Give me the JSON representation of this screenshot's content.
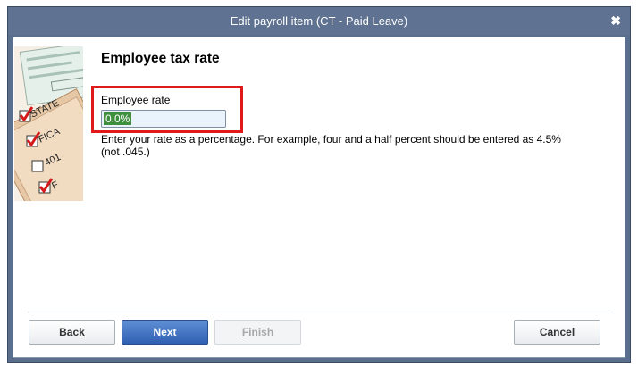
{
  "window": {
    "title": "Edit payroll item (CT - Paid Leave)",
    "close_label": "✖"
  },
  "page": {
    "heading": "Employee tax rate",
    "field_label": "Employee rate",
    "field_value": "0.0%",
    "help_text": "Enter your rate as a percentage.  For example, four and a half percent should be entered as 4.5% (not .045.)"
  },
  "art": {
    "labels": [
      "STATE",
      "FICA",
      "401",
      "F"
    ]
  },
  "buttons": {
    "back_pre": "Bac",
    "back_ul": "k",
    "next_ul": "N",
    "next_post": "ext",
    "finish_ul": "F",
    "finish_post": "inish",
    "cancel": "Cancel"
  },
  "colors": {
    "title_bar": "#5f7291",
    "highlight": "#e01a1a",
    "selection": "#3e8f3e",
    "primary_button": "#2f5fb2"
  }
}
